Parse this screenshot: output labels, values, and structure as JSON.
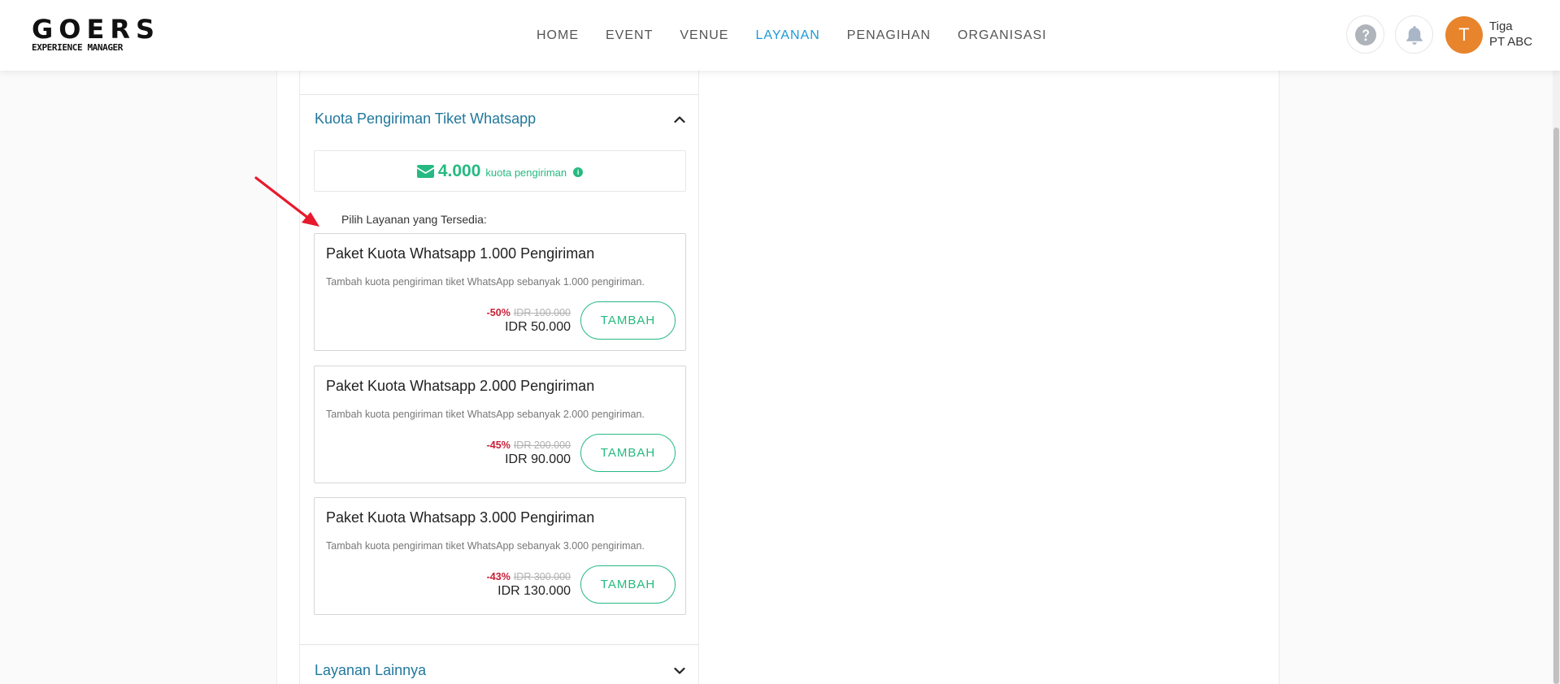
{
  "brand": {
    "logo_main": "GOERS",
    "logo_sub": "EXPERIENCE MANAGER"
  },
  "nav": {
    "items": [
      {
        "label": "HOME",
        "active": false
      },
      {
        "label": "EVENT",
        "active": false
      },
      {
        "label": "VENUE",
        "active": false
      },
      {
        "label": "LAYANAN",
        "active": true
      },
      {
        "label": "PENAGIHAN",
        "active": false
      },
      {
        "label": "ORGANISASI",
        "active": false
      }
    ]
  },
  "user": {
    "initial": "T",
    "name": "Tiga",
    "org": "PT ABC"
  },
  "icons": {
    "help": "question-circle-icon",
    "notifications": "bell-icon",
    "quota": "envelope-icon",
    "info": "info-icon",
    "collapse": "chevron-up-icon",
    "expand": "chevron-down-icon"
  },
  "whatsapp_section": {
    "title": "Kuota Pengiriman Tiket Whatsapp",
    "quota_value": "4.000",
    "quota_label": "kuota pengiriman",
    "choose_label": "Pilih Layanan yang Tersedia:",
    "packages": [
      {
        "title": "Paket Kuota Whatsapp 1.000 Pengiriman",
        "description": "Tambah kuota pengiriman tiket WhatsApp sebanyak 1.000 pengiriman.",
        "discount": "-50%",
        "original_price": "IDR 100.000",
        "price": "IDR 50.000",
        "button_label": "TAMBAH"
      },
      {
        "title": "Paket Kuota Whatsapp 2.000 Pengiriman",
        "description": "Tambah kuota pengiriman tiket WhatsApp sebanyak 2.000 pengiriman.",
        "discount": "-45%",
        "original_price": "IDR 200.000",
        "price": "IDR 90.000",
        "button_label": "TAMBAH"
      },
      {
        "title": "Paket Kuota Whatsapp 3.000 Pengiriman",
        "description": "Tambah kuota pengiriman tiket WhatsApp sebanyak 3.000 pengiriman.",
        "discount": "-43%",
        "original_price": "IDR 300.000",
        "price": "IDR 130.000",
        "button_label": "TAMBAH"
      }
    ]
  },
  "other_section": {
    "title": "Layanan Lainnya"
  },
  "colors": {
    "accent_blue": "#1b9ad6",
    "section_title": "#22789d",
    "green": "#26b981",
    "discount_red": "#c81e35",
    "avatar_orange": "#e8842c",
    "annotation_arrow": "#e8192c"
  }
}
